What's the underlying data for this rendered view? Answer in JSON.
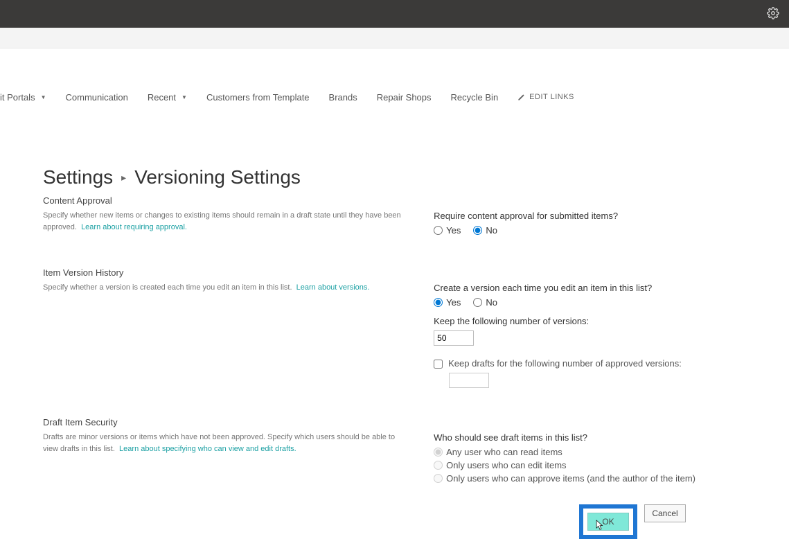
{
  "nav": {
    "items": [
      {
        "label": "it Portals",
        "hasDropdown": true
      },
      {
        "label": "Communication",
        "hasDropdown": false
      },
      {
        "label": "Recent",
        "hasDropdown": true
      },
      {
        "label": "Customers from Template",
        "hasDropdown": false
      },
      {
        "label": "Brands",
        "hasDropdown": false
      },
      {
        "label": "Repair Shops",
        "hasDropdown": false
      },
      {
        "label": "Recycle Bin",
        "hasDropdown": false
      }
    ],
    "editLinks": "EDIT LINKS"
  },
  "breadcrumb": {
    "root": "Settings",
    "current": "Versioning Settings"
  },
  "contentApproval": {
    "title": "Content Approval",
    "desc": "Specify whether new items or changes to existing items should remain in a draft state until they have been approved.",
    "link": "Learn about requiring approval.",
    "question": "Require content approval for submitted items?",
    "options": {
      "yes": "Yes",
      "no": "No"
    },
    "selected": "no"
  },
  "versionHistory": {
    "title": "Item Version History",
    "desc": "Specify whether a version is created each time you edit an item in this list.",
    "link": "Learn about versions.",
    "question": "Create a version each time you edit an item in this list?",
    "options": {
      "yes": "Yes",
      "no": "No"
    },
    "selected": "yes",
    "keepVersionsLabel": "Keep the following number of versions:",
    "keepVersionsValue": "50",
    "keepDraftsLabel": "Keep drafts for the following number of approved versions:"
  },
  "draftSecurity": {
    "title": "Draft Item Security",
    "desc": "Drafts are minor versions or items which have not been approved. Specify which users should be able to view drafts in this list.",
    "link": "Learn about specifying who can view and edit drafts.",
    "question": "Who should see draft items in this list?",
    "options": [
      "Any user who can read items",
      "Only users who can edit items",
      "Only users who can approve items (and the author of the item)"
    ],
    "selected": 0
  },
  "buttons": {
    "ok": "OK",
    "cancel": "Cancel"
  }
}
